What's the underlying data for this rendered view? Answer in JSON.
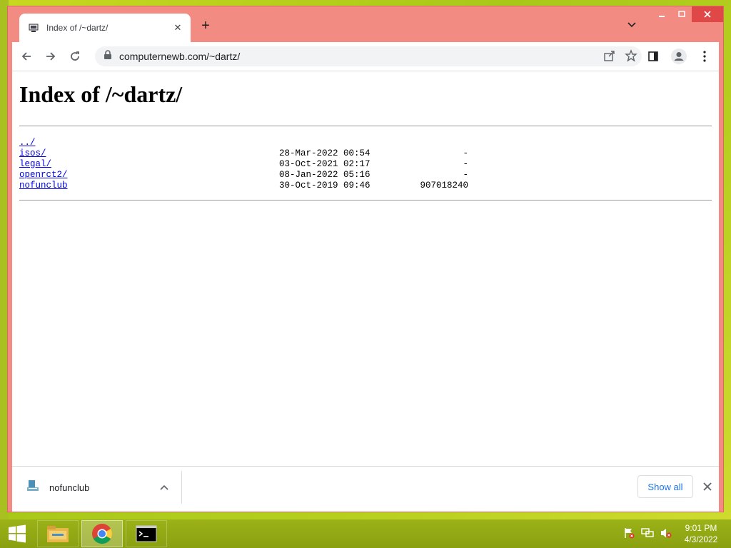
{
  "browser": {
    "tab_title": "Index of /~dartz/",
    "url": "computernewb.com/~dartz/"
  },
  "page": {
    "heading": "Index of /~dartz/",
    "entries": [
      {
        "name": "../",
        "date": "",
        "size": ""
      },
      {
        "name": "isos/",
        "date": "28-Mar-2022 00:54",
        "size": "-"
      },
      {
        "name": "legal/",
        "date": "03-Oct-2021 02:17",
        "size": "-"
      },
      {
        "name": "openrct2/",
        "date": "08-Jan-2022 05:16",
        "size": "-"
      },
      {
        "name": "nofunclub",
        "date": "30-Oct-2019 09:46",
        "size": "907018240"
      }
    ]
  },
  "downloads": {
    "file_name": "nofunclub",
    "show_all_label": "Show all"
  },
  "taskbar": {
    "apps": [
      "file-explorer",
      "chrome",
      "command-prompt"
    ],
    "time": "9:01 PM",
    "date": "4/3/2022"
  },
  "colors": {
    "window_frame": "#f28b82",
    "link": "#0000ee",
    "taskbar": "#8aa010"
  }
}
